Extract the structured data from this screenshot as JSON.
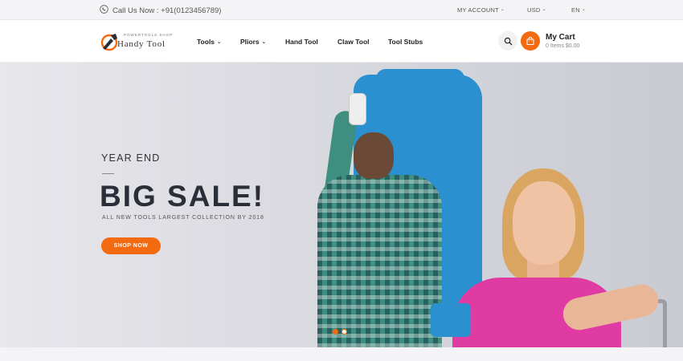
{
  "topbar": {
    "call_text": "Call Us Now : +91(0123456789)",
    "account_label": "MY ACCOUNT",
    "currency_label": "USD",
    "language_label": "EN"
  },
  "logo": {
    "tagline": "POWERTOOLS SHOP",
    "name": "Handy Tool"
  },
  "nav": {
    "items": [
      {
        "label": "Tools",
        "has_dropdown": true
      },
      {
        "label": "Pliors",
        "has_dropdown": true
      },
      {
        "label": "Hand Tool",
        "has_dropdown": false
      },
      {
        "label": "Claw Tool",
        "has_dropdown": false
      },
      {
        "label": "Tool Stubs",
        "has_dropdown": false
      }
    ]
  },
  "cart": {
    "title": "My Cart",
    "summary": "0 Items $0.00"
  },
  "hero": {
    "eyebrow": "YEAR END",
    "headline": "BIG SALE!",
    "subtitle": "ALL NEW TOOLS LARGEST COLLECTION BY 2018",
    "cta_label": "SHOP NOW",
    "slide_count": 2,
    "active_slide": 1
  },
  "colors": {
    "accent": "#f36a10",
    "headline": "#2a2e38"
  },
  "icons": [
    "phone-icon",
    "chevron-down-icon",
    "search-icon",
    "shopping-bag-icon"
  ]
}
